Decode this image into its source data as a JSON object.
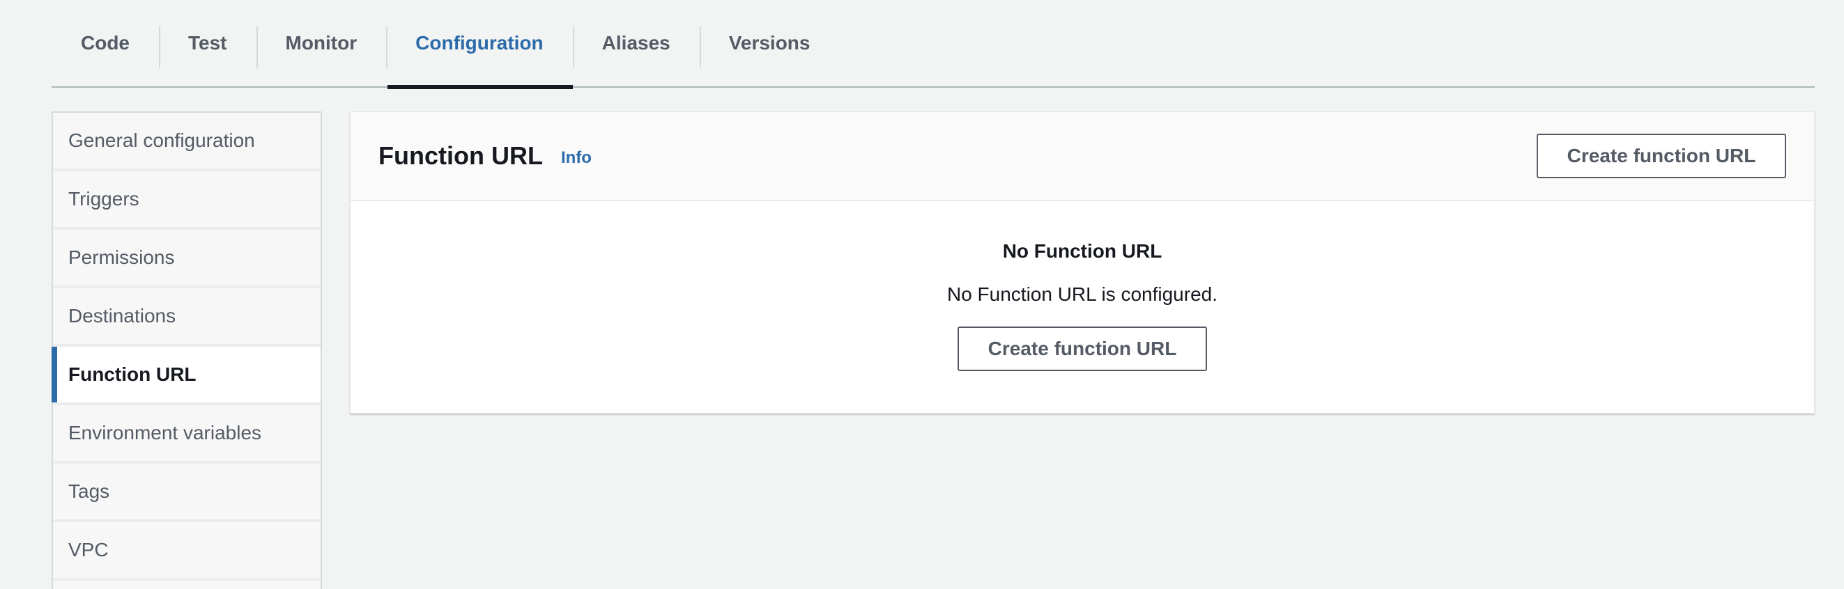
{
  "tabs": [
    {
      "label": "Code"
    },
    {
      "label": "Test"
    },
    {
      "label": "Monitor"
    },
    {
      "label": "Configuration"
    },
    {
      "label": "Aliases"
    },
    {
      "label": "Versions"
    }
  ],
  "active_tab": "Configuration",
  "sidebar": {
    "items": [
      {
        "label": "General configuration"
      },
      {
        "label": "Triggers"
      },
      {
        "label": "Permissions"
      },
      {
        "label": "Destinations"
      },
      {
        "label": "Function URL"
      },
      {
        "label": "Environment variables"
      },
      {
        "label": "Tags"
      },
      {
        "label": "VPC"
      }
    ],
    "active": "Function URL"
  },
  "panel": {
    "title": "Function URL",
    "info_label": "Info",
    "header_button_label": "Create function URL",
    "empty_title": "No Function URL",
    "empty_description": "No Function URL is configured.",
    "body_button_label": "Create function URL"
  },
  "colors": {
    "accent": "#2c6ba9",
    "background": "#f2f3f3",
    "text": "#16191f",
    "muted_text": "#545b64"
  }
}
